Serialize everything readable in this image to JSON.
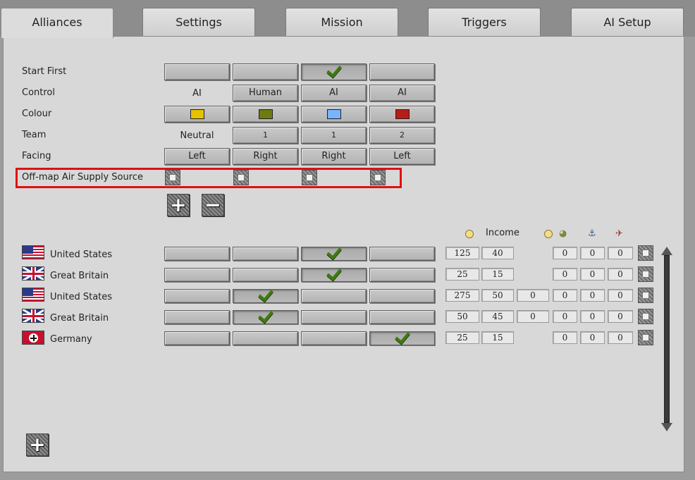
{
  "tabs": [
    {
      "label": "Alliances",
      "active": true
    },
    {
      "label": "Settings",
      "active": false
    },
    {
      "label": "Mission",
      "active": false
    },
    {
      "label": "Triggers",
      "active": false
    },
    {
      "label": "AI Setup",
      "active": false
    }
  ],
  "rows": {
    "start_first": {
      "label": "Start First",
      "checked_column": 3
    },
    "control": {
      "label": "Control",
      "values": [
        "AI",
        "Human",
        "AI",
        "AI"
      ]
    },
    "colour": {
      "label": "Colour",
      "colors": [
        "#e6c200",
        "#6f7a10",
        "#7ab4ff",
        "#b81c16"
      ]
    },
    "team": {
      "label": "Team",
      "values": [
        "Neutral",
        "1",
        "1",
        "2"
      ]
    },
    "facing": {
      "label": "Facing",
      "values": [
        "Left",
        "Right",
        "Right",
        "Left"
      ]
    },
    "air_supply": {
      "label": "Off-map Air Supply Source",
      "checked": [
        false,
        false,
        false,
        false
      ]
    }
  },
  "resource_header": {
    "income_label": "Income",
    "icons": [
      "gold-coin-icon",
      "income-coin-icon",
      "helmet-icon",
      "anchor-icon",
      "plane-icon"
    ]
  },
  "nations": [
    {
      "name": "United States",
      "flag": "us",
      "side_checked": 3,
      "gold": "125",
      "income": "40",
      "extra": "",
      "r1": "0",
      "r2": "0",
      "r3": "0"
    },
    {
      "name": "Great Britain",
      "flag": "gb",
      "side_checked": 3,
      "gold": "25",
      "income": "15",
      "extra": "",
      "r1": "0",
      "r2": "0",
      "r3": "0"
    },
    {
      "name": "United States",
      "flag": "us",
      "side_checked": 2,
      "gold": "275",
      "income": "50",
      "extra": "0",
      "r1": "0",
      "r2": "0",
      "r3": "0"
    },
    {
      "name": "Great Britain",
      "flag": "gb",
      "side_checked": 2,
      "gold": "50",
      "income": "45",
      "extra": "0",
      "r1": "0",
      "r2": "0",
      "r3": "0"
    },
    {
      "name": "Germany",
      "flag": "de",
      "side_checked": 4,
      "gold": "25",
      "income": "15",
      "extra": "",
      "r1": "0",
      "r2": "0",
      "r3": "0"
    }
  ],
  "buttons": {
    "add": "+",
    "remove": "−",
    "add_nation": "+"
  }
}
